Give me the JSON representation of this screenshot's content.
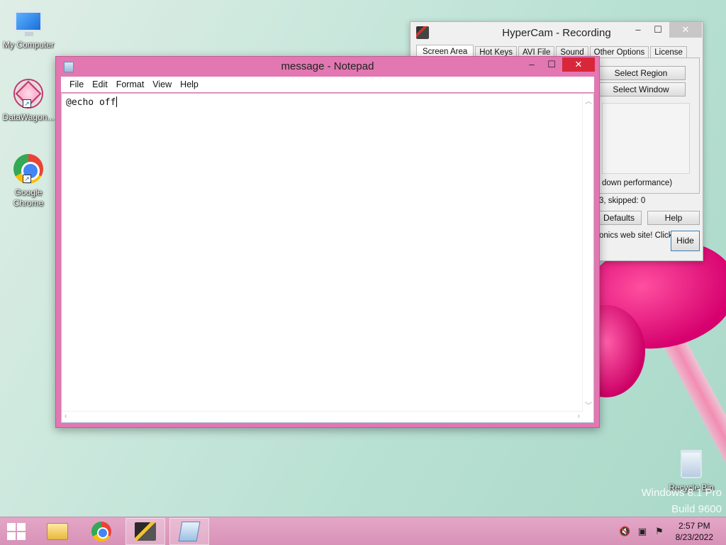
{
  "desktop": {
    "icons": [
      {
        "label": "My Computer",
        "icon": "computer-icon"
      },
      {
        "label": "DataWagon...",
        "icon": "datawagon-icon"
      },
      {
        "label": "Google Chrome",
        "icon": "chrome-icon"
      },
      {
        "label": "Recycle Bin",
        "icon": "recycle-bin-icon"
      }
    ],
    "watermark": {
      "line1": "Windows 8.1 Pro",
      "line2": "Build 9600"
    }
  },
  "hypercam": {
    "title": "HyperCam - Recording",
    "tabs": [
      {
        "label": "Screen Area",
        "active": true
      },
      {
        "label": "Hot Keys"
      },
      {
        "label": "AVI File"
      },
      {
        "label": "Sound"
      },
      {
        "label": "Other Options"
      },
      {
        "label": "License"
      }
    ],
    "buttons": {
      "select_region": "Select Region",
      "select_window": "Select Window",
      "defaults": "Defaults",
      "help": "Help",
      "hide": "Hide"
    },
    "text": {
      "performance": "down performance)",
      "skipped": "3, skipped: 0",
      "website": "onics web site! Click"
    }
  },
  "notepad": {
    "title": "message - Notepad",
    "menu": [
      "File",
      "Edit",
      "Format",
      "View",
      "Help"
    ],
    "content": "@echo off"
  },
  "taskbar": {
    "clock": {
      "time": "2:57 PM",
      "date": "8/23/2022"
    },
    "items": [
      "file-explorer-icon",
      "chrome-icon",
      "hypercam-icon",
      "notepad-icon"
    ]
  },
  "colors": {
    "window_frame": "#e277b2",
    "close_button": "#d8273a",
    "taskbar": "#d892b8"
  }
}
